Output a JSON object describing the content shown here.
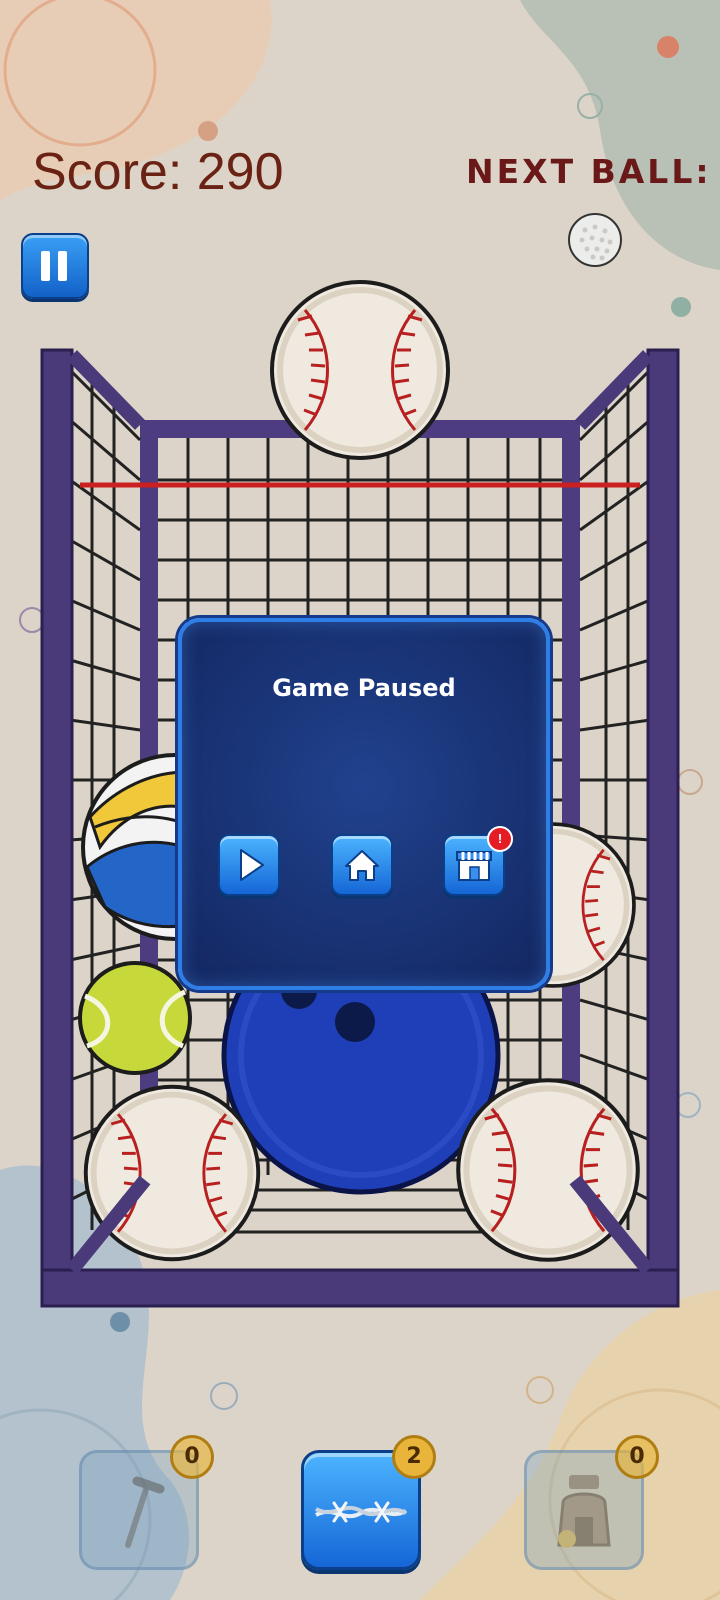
{
  "hud": {
    "score_text": "Score: 290",
    "next_ball_label": "NEXT BALL:",
    "next_ball_icon": "golf-ball-icon"
  },
  "pause_button": {
    "icon": "pause-icon"
  },
  "balls_in_cage": [
    "baseball",
    "volleyball",
    "tennis-ball",
    "bowling-ball",
    "baseball",
    "baseball",
    "baseball"
  ],
  "pause_dialog": {
    "title": "Game Paused",
    "buttons": [
      {
        "icon": "play-icon"
      },
      {
        "icon": "home-icon"
      },
      {
        "icon": "shop-icon",
        "notification": "!"
      }
    ]
  },
  "powerups": [
    {
      "icon": "nail-icon",
      "count": "0",
      "state": "disabled"
    },
    {
      "icon": "barbed-wire-icon",
      "count": "2",
      "state": "active"
    },
    {
      "icon": "vacuum-icon",
      "count": "0",
      "state": "disabled"
    }
  ],
  "colors": {
    "score_text": "#6a2214",
    "cage": "#4a3a7a",
    "limit_line": "#cc1f1f",
    "dialog_bg": "#1b3578",
    "button_blue": "#1e7fe8"
  }
}
